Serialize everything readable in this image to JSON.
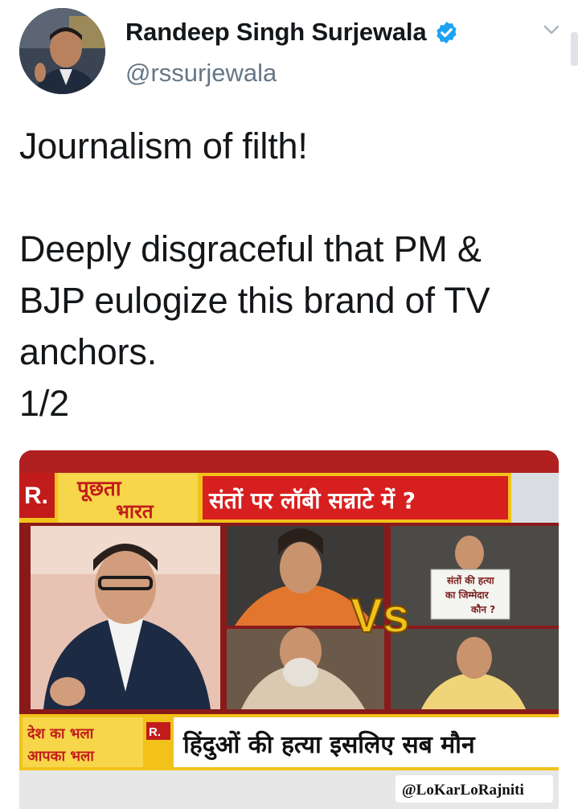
{
  "tweet": {
    "author_name": "Randeep Singh Surjewala",
    "handle": "@rssurjewala",
    "text": "Journalism of filth!\n\nDeeply disgraceful that PM &\nBJP eulogize this brand of TV\nanchors.\n1/2"
  },
  "media": {
    "logo_letter": "R.",
    "show_name_line1": "पूछता",
    "show_name_line2": "भारत",
    "headline_top": "संतों पर लॉबी सन्नाटे में ?",
    "vs_label": "Vs",
    "placard_line1": "संतों की हत्या",
    "placard_line2": "का जिम्मेदार",
    "placard_line3": "कौन ?",
    "corner_tag_line1": "देश का भला",
    "corner_tag_line2": "आपका भला",
    "small_logo": "R.",
    "ticker_text": "हिंदुओं की हत्या इसलिए सब मौन",
    "watermark": "@LoKarLoRajniti"
  },
  "colors": {
    "verified_blue": "#1da1f2",
    "handle_gray": "#657786",
    "banner_red": "#d81f1f",
    "banner_yellow": "#f2c21a"
  },
  "icons": {
    "verified": "verified-badge-icon",
    "menu": "chevron-down-icon"
  }
}
